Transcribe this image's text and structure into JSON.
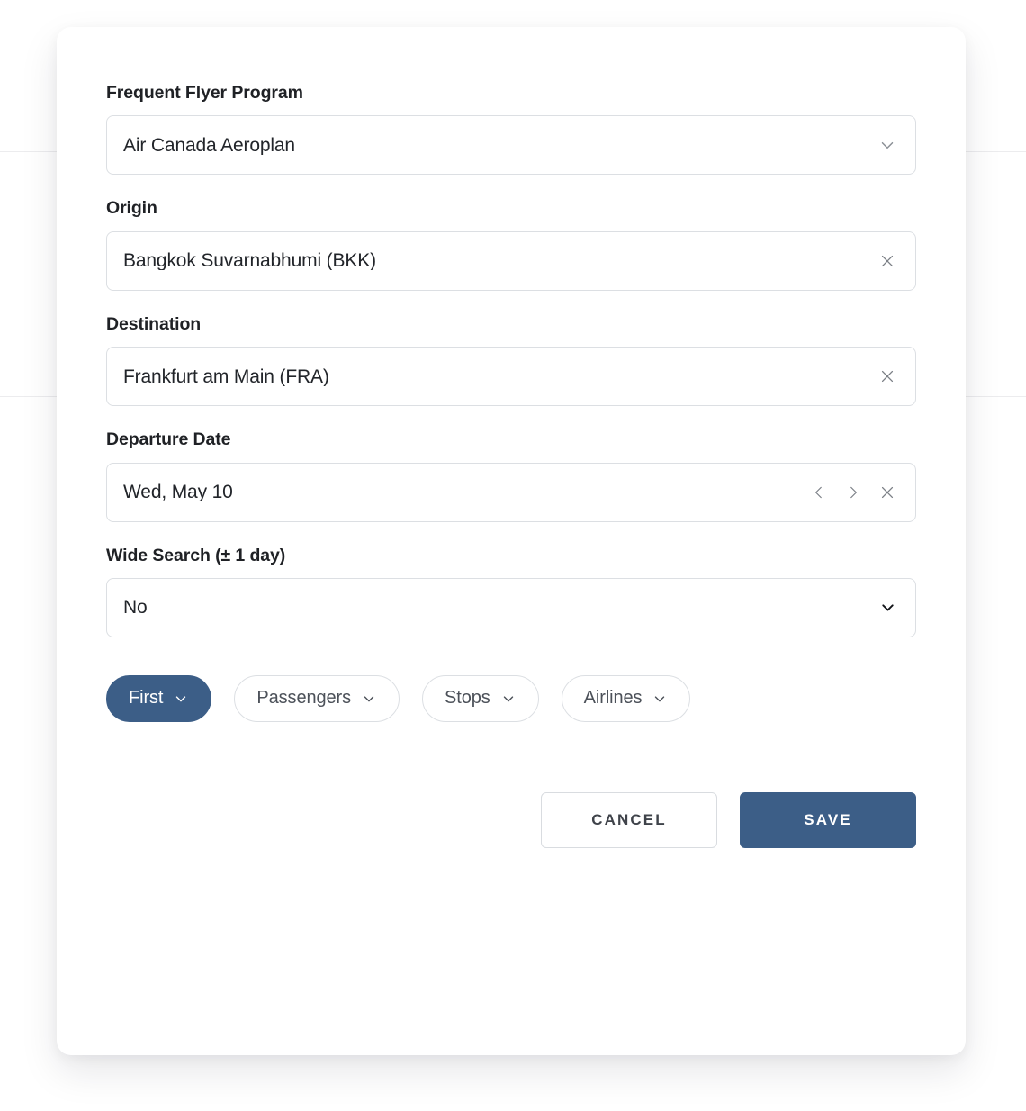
{
  "backdrop": {
    "note": ""
  },
  "modal": {
    "fields": [
      {
        "label": "Frequent Flyer Program",
        "value": "Air Canada Aeroplan",
        "type": "dropdown",
        "icons": [
          "chevron-down-icon"
        ]
      },
      {
        "label": "Origin",
        "value": "Bangkok Suvarnabhumi (BKK)",
        "type": "text",
        "icons": [
          "clear-icon"
        ]
      },
      {
        "label": "Destination",
        "value": "Frankfurt am Main (FRA)",
        "type": "text",
        "icons": [
          "clear-icon"
        ]
      },
      {
        "label": "Departure Date",
        "value": "Wed, May 10",
        "type": "date",
        "icons": [
          "chevron-left-icon",
          "chevron-right-icon",
          "clear-icon"
        ]
      },
      {
        "label": "Wide Search (± 1 day)",
        "value": "No",
        "type": "select",
        "icons": [
          "chevron-down-icon"
        ]
      }
    ],
    "chips": [
      {
        "label": "First",
        "active": true,
        "caret": "chevron-down-icon"
      },
      {
        "label": "Passengers",
        "active": false,
        "caret": "chevron-down-icon"
      },
      {
        "label": "Stops",
        "active": false,
        "caret": "chevron-down-icon"
      },
      {
        "label": "Airlines",
        "active": false,
        "caret": "chevron-down-icon"
      }
    ],
    "footer": {
      "cancel_label": "CANCEL",
      "save_label": "SAVE"
    },
    "colors": {
      "accent": "#3c5e87",
      "border": "#dcdfe3",
      "text": "#22252a",
      "muted": "#7b7f86"
    }
  }
}
